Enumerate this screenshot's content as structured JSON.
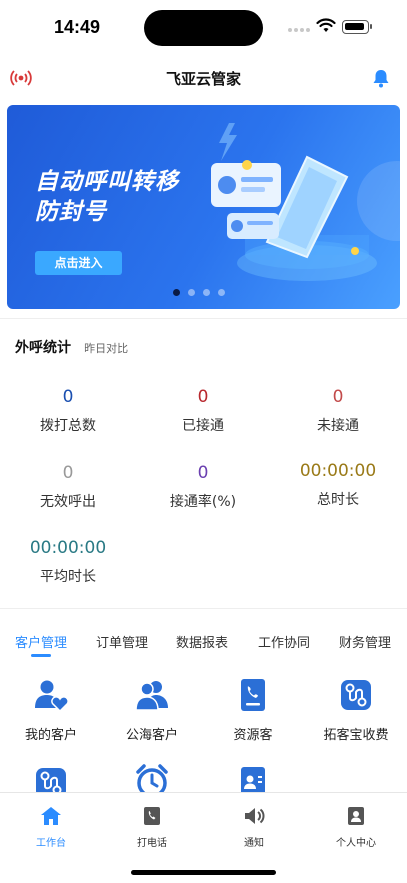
{
  "status_bar": {
    "time": "14:49"
  },
  "nav": {
    "title": "飞亚云管家"
  },
  "banner": {
    "line1": "自动呼叫转移",
    "line2": "防封号",
    "button": "点击进入",
    "page_count": 4,
    "active_page": 1
  },
  "call_stats": {
    "title": "外呼统计",
    "subtitle": "昨日对比",
    "items": [
      {
        "value": "0",
        "label": "拨打总数",
        "color": "#1a4fb0"
      },
      {
        "value": "0",
        "label": "已接通",
        "color": "#b8282e"
      },
      {
        "value": "0",
        "label": "未接通",
        "color": "#c24a4a"
      },
      {
        "value": "0",
        "label": "无效呼出",
        "color": "#999999"
      },
      {
        "value": "0",
        "label": "接通率(%)",
        "color": "#6a3fb0"
      },
      {
        "value": "00:00:00",
        "label": "总时长",
        "color": "#9a7a18"
      },
      {
        "value": "00:00:00",
        "label": "平均时长",
        "color": "#2a7a85"
      }
    ]
  },
  "tabs": {
    "items": [
      "客户管理",
      "订单管理",
      "数据报表",
      "工作协同",
      "财务管理"
    ],
    "active": 0
  },
  "grid": {
    "items": [
      {
        "label": "我的客户",
        "icon": "contacts-heart-icon"
      },
      {
        "label": "公海客户",
        "icon": "group-icon"
      },
      {
        "label": "资源客",
        "icon": "phone-doc-icon"
      },
      {
        "label": "拓客宝收费",
        "icon": "route-icon"
      },
      {
        "label": "",
        "icon": "route-icon"
      },
      {
        "label": "",
        "icon": "alarm-clock-icon"
      },
      {
        "label": "",
        "icon": "contact-card-icon"
      }
    ]
  },
  "tabbar": {
    "items": [
      {
        "label": "工作台",
        "icon": "home-icon"
      },
      {
        "label": "打电话",
        "icon": "phone-icon"
      },
      {
        "label": "通知",
        "icon": "speaker-icon"
      },
      {
        "label": "个人中心",
        "icon": "profile-icon"
      }
    ],
    "active": 0
  },
  "colors": {
    "accent": "#2b8cff",
    "banner_blue": "#2b74ee"
  }
}
